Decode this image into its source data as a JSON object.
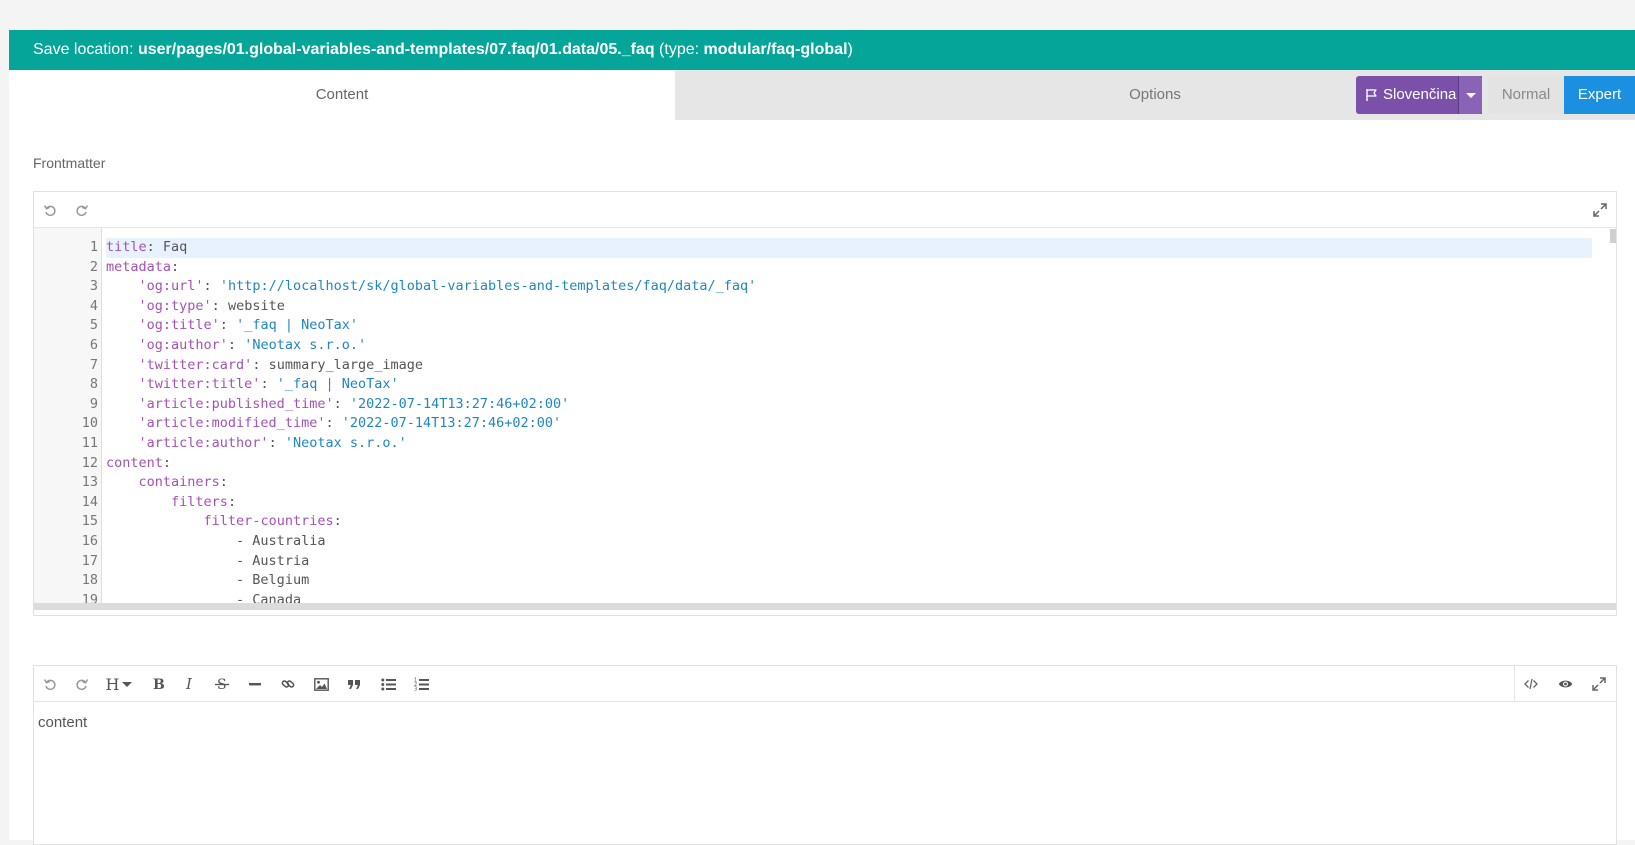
{
  "save_bar": {
    "prefix": "Save location: ",
    "path": "user/pages/01.global-variables-and-templates/07.faq/01.data/05._faq",
    "type_open": " (type: ",
    "type_value": "modular/faq-global",
    "type_close": ")"
  },
  "tabs": [
    {
      "label": "Content",
      "active": true
    },
    {
      "label": "Options",
      "active": false
    }
  ],
  "language": {
    "label": "Slovenčina",
    "icon": "flag-icon"
  },
  "modes": {
    "normal": "Normal",
    "expert": "Expert",
    "active": "expert"
  },
  "frontmatter": {
    "label": "Frontmatter",
    "lines": [
      {
        "n": "1",
        "indent": "",
        "key": "title",
        "sep": ": ",
        "val": "Faq",
        "str": ""
      },
      {
        "n": "2",
        "indent": "",
        "key": "metadata",
        "sep": ":",
        "val": "",
        "str": ""
      },
      {
        "n": "3",
        "indent": "    ",
        "key": "'og:url'",
        "sep": ": ",
        "val": "",
        "str": "'http://localhost/sk/global-variables-and-templates/faq/data/_faq'"
      },
      {
        "n": "4",
        "indent": "    ",
        "key": "'og:type'",
        "sep": ": ",
        "val": "website",
        "str": ""
      },
      {
        "n": "5",
        "indent": "    ",
        "key": "'og:title'",
        "sep": ": ",
        "val": "",
        "str": "'_faq | NeoTax'"
      },
      {
        "n": "6",
        "indent": "    ",
        "key": "'og:author'",
        "sep": ": ",
        "val": "",
        "str": "'Neotax s.r.o.'"
      },
      {
        "n": "7",
        "indent": "    ",
        "key": "'twitter:card'",
        "sep": ": ",
        "val": "summary_large_image",
        "str": ""
      },
      {
        "n": "8",
        "indent": "    ",
        "key": "'twitter:title'",
        "sep": ": ",
        "val": "",
        "str": "'_faq | NeoTax'"
      },
      {
        "n": "9",
        "indent": "    ",
        "key": "'article:published_time'",
        "sep": ": ",
        "val": "",
        "str": "'2022-07-14T13:27:46+02:00'"
      },
      {
        "n": "10",
        "indent": "    ",
        "key": "'article:modified_time'",
        "sep": ": ",
        "val": "",
        "str": "'2022-07-14T13:27:46+02:00'"
      },
      {
        "n": "11",
        "indent": "    ",
        "key": "'article:author'",
        "sep": ": ",
        "val": "",
        "str": "'Neotax s.r.o.'"
      },
      {
        "n": "12",
        "indent": "",
        "key": "content",
        "sep": ":",
        "val": "",
        "str": ""
      },
      {
        "n": "13",
        "indent": "    ",
        "key": "containers",
        "sep": ":",
        "val": "",
        "str": ""
      },
      {
        "n": "14",
        "indent": "        ",
        "key": "filters",
        "sep": ":",
        "val": "",
        "str": ""
      },
      {
        "n": "15",
        "indent": "            ",
        "key": "filter-countries",
        "sep": ":",
        "val": "",
        "str": ""
      },
      {
        "n": "16",
        "indent": "                ",
        "key": "",
        "sep": "",
        "val": "- Australia",
        "str": ""
      },
      {
        "n": "17",
        "indent": "                ",
        "key": "",
        "sep": "",
        "val": "- Austria",
        "str": ""
      },
      {
        "n": "18",
        "indent": "                ",
        "key": "",
        "sep": "",
        "val": "- Belgium",
        "str": ""
      },
      {
        "n": "19",
        "indent": "                ",
        "key": "",
        "sep": "",
        "val": "- Canada",
        "str": ""
      }
    ]
  },
  "markdown": {
    "content": "content",
    "heading_label": "H"
  },
  "colors": {
    "save_bar": "#06a599",
    "language": "#7a50a8",
    "expert": "#1b8fe0",
    "yaml_key": "#a352b5",
    "yaml_string": "#1f87c0"
  }
}
